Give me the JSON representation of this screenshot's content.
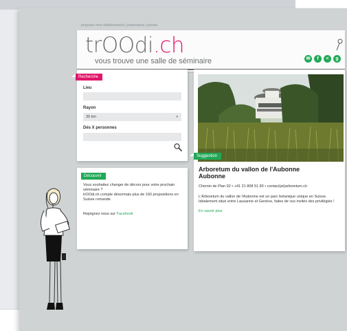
{
  "topnav": {
    "items": [
      "proposer mon établissement",
      "partenaires",
      "presse"
    ],
    "separator": " | "
  },
  "brand": {
    "logo_part1": "trOOdi",
    "logo_dot": ".",
    "logo_part2": "ch",
    "tagline": "vous trouve une salle de séminaire",
    "accent_color": "#e2156b"
  },
  "social_icons": [
    "email-icon",
    "facebook-icon",
    "share-icon",
    "google-icon"
  ],
  "search": {
    "tab_label": "Recherche",
    "lieu_label": "Lieu",
    "lieu_value": "",
    "rayon_label": "Rayon",
    "rayon_value": "30 km",
    "persons_label": "Dès X personnes",
    "persons_value": ""
  },
  "discover": {
    "tab_label": "Découvrir",
    "paragraph1": "Vous souhaitez changer de décors pour votre prochain séminaire ?",
    "paragraph2": "trOOdi.ch compte désormais plus de 160 propositions en Suisse romande.",
    "join_prefix": "Rejoignez nous sur ",
    "join_link": "Facebook"
  },
  "suggestion": {
    "tab_label": "Suggestion",
    "title_line1": "Arboretum du vallon de l'Aubonne",
    "title_line2": "Aubonne",
    "contact": "Chemin de Plan 92 • +41 21 808 51 83 • contact(at)arboretum.ch",
    "description": "L'Arboretum du vallon de l'Aubonne est un parc botanique unique en Suisse. Idéalement situé entre Lausanne et Genève, faites de vos invités des privilégiés !",
    "more_link": "En savoir plus"
  },
  "colors": {
    "pink": "#e2156b",
    "green": "#21a857",
    "background": "#cfd3d3"
  }
}
